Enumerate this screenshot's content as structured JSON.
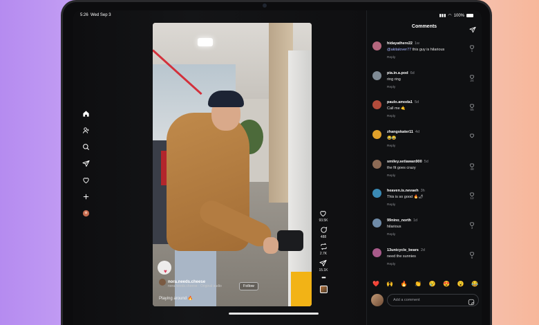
{
  "status_bar": {
    "time": "5:26",
    "date": "Wed Sep 3",
    "battery": "100%"
  },
  "nav": {
    "items": [
      "home",
      "people",
      "search",
      "messages",
      "activity",
      "create",
      "profile"
    ]
  },
  "reel": {
    "author": "nora.needs.cheese",
    "audio": "nora.needs.cheese · Original audio",
    "follow_label": "Follow",
    "caption": "Playing around 🔥",
    "likes": "93.5K",
    "comments": "488",
    "reposts": "2.7K",
    "shares": "15.1K",
    "more": "•••"
  },
  "comments_panel": {
    "title": "Comments",
    "reply_label": "Reply",
    "items": [
      {
        "user": "hidayathere22",
        "time": "1w",
        "mention": "@akitalover77",
        "text": "this guy is hilarious",
        "likes": "1",
        "avatar_color": "#b5677e"
      },
      {
        "user": "pia.in.a.pod",
        "time": "6d",
        "text": "ring ring",
        "likes": "24",
        "avatar_color": "#7f8a94"
      },
      {
        "user": "paulo.amoda1",
        "time": "5d",
        "text": "Call me 🤙",
        "likes": "55",
        "avatar_color": "#b24b3b"
      },
      {
        "user": "zhangskater11",
        "time": "4d",
        "text": "😂😂",
        "likes": "",
        "avatar_color": "#e0a02a"
      },
      {
        "user": "smiley.setiawan900",
        "time": "5d",
        "text": "the fit goes crazy",
        "likes": "48",
        "avatar_color": "#8c6a55"
      },
      {
        "user": "heaven.is.nevaeh",
        "time": "3h",
        "text": "This is so good 🔥🌶",
        "likes": "12",
        "avatar_color": "#3a8ab5"
      },
      {
        "user": "99nino_north",
        "time": "1d",
        "text": "hilarious",
        "likes": "3",
        "avatar_color": "#6f8ba8"
      },
      {
        "user": "13unicycle_bears",
        "time": "2d",
        "text": "need the sunnies",
        "likes": "6",
        "avatar_color": "#a85a8a"
      }
    ],
    "quick_emojis": [
      "❤️",
      "🙌",
      "🔥",
      "👏",
      "😢",
      "😍",
      "😮",
      "😂"
    ],
    "input_placeholder": "Add a comment"
  },
  "colors": {
    "accent_link": "#a8b5ff",
    "background": "#0f1012",
    "like_heart": "#e8345a"
  }
}
